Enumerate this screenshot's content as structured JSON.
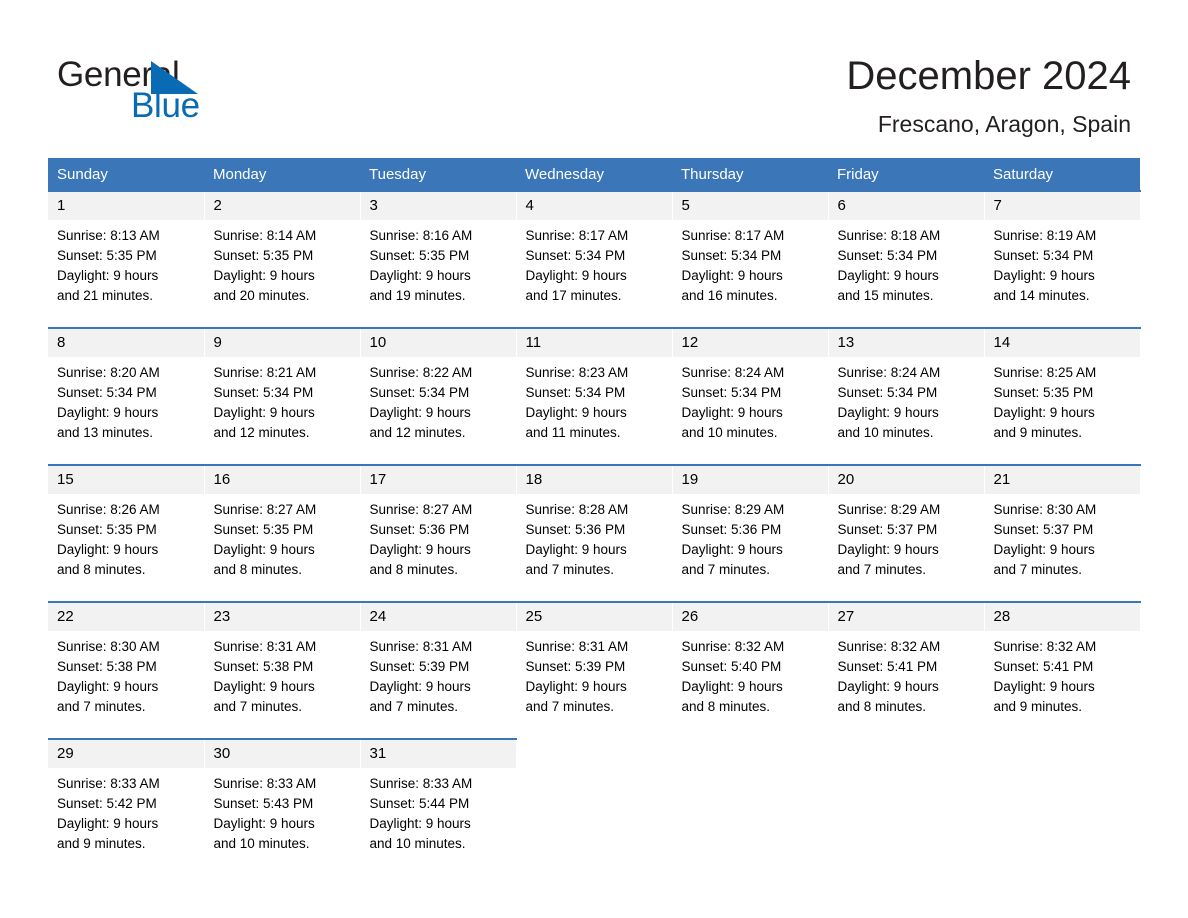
{
  "brand": {
    "name_part1": "General",
    "name_part2": "Blue",
    "accent_color": "#0a6bb5",
    "triangle_icon": "triangle-icon"
  },
  "header": {
    "title": "December 2024",
    "location": "Frescano, Aragon, Spain"
  },
  "calendar": {
    "header_bg": "#3a76b8",
    "daynum_bg": "#f2f2f2",
    "weekday_headers": [
      "Sunday",
      "Monday",
      "Tuesday",
      "Wednesday",
      "Thursday",
      "Friday",
      "Saturday"
    ],
    "weeks": [
      [
        {
          "day": "1",
          "sunrise": "Sunrise: 8:13 AM",
          "sunset": "Sunset: 5:35 PM",
          "daylight_line1": "Daylight: 9 hours",
          "daylight_line2": "and 21 minutes."
        },
        {
          "day": "2",
          "sunrise": "Sunrise: 8:14 AM",
          "sunset": "Sunset: 5:35 PM",
          "daylight_line1": "Daylight: 9 hours",
          "daylight_line2": "and 20 minutes."
        },
        {
          "day": "3",
          "sunrise": "Sunrise: 8:16 AM",
          "sunset": "Sunset: 5:35 PM",
          "daylight_line1": "Daylight: 9 hours",
          "daylight_line2": "and 19 minutes."
        },
        {
          "day": "4",
          "sunrise": "Sunrise: 8:17 AM",
          "sunset": "Sunset: 5:34 PM",
          "daylight_line1": "Daylight: 9 hours",
          "daylight_line2": "and 17 minutes."
        },
        {
          "day": "5",
          "sunrise": "Sunrise: 8:17 AM",
          "sunset": "Sunset: 5:34 PM",
          "daylight_line1": "Daylight: 9 hours",
          "daylight_line2": "and 16 minutes."
        },
        {
          "day": "6",
          "sunrise": "Sunrise: 8:18 AM",
          "sunset": "Sunset: 5:34 PM",
          "daylight_line1": "Daylight: 9 hours",
          "daylight_line2": "and 15 minutes."
        },
        {
          "day": "7",
          "sunrise": "Sunrise: 8:19 AM",
          "sunset": "Sunset: 5:34 PM",
          "daylight_line1": "Daylight: 9 hours",
          "daylight_line2": "and 14 minutes."
        }
      ],
      [
        {
          "day": "8",
          "sunrise": "Sunrise: 8:20 AM",
          "sunset": "Sunset: 5:34 PM",
          "daylight_line1": "Daylight: 9 hours",
          "daylight_line2": "and 13 minutes."
        },
        {
          "day": "9",
          "sunrise": "Sunrise: 8:21 AM",
          "sunset": "Sunset: 5:34 PM",
          "daylight_line1": "Daylight: 9 hours",
          "daylight_line2": "and 12 minutes."
        },
        {
          "day": "10",
          "sunrise": "Sunrise: 8:22 AM",
          "sunset": "Sunset: 5:34 PM",
          "daylight_line1": "Daylight: 9 hours",
          "daylight_line2": "and 12 minutes."
        },
        {
          "day": "11",
          "sunrise": "Sunrise: 8:23 AM",
          "sunset": "Sunset: 5:34 PM",
          "daylight_line1": "Daylight: 9 hours",
          "daylight_line2": "and 11 minutes."
        },
        {
          "day": "12",
          "sunrise": "Sunrise: 8:24 AM",
          "sunset": "Sunset: 5:34 PM",
          "daylight_line1": "Daylight: 9 hours",
          "daylight_line2": "and 10 minutes."
        },
        {
          "day": "13",
          "sunrise": "Sunrise: 8:24 AM",
          "sunset": "Sunset: 5:34 PM",
          "daylight_line1": "Daylight: 9 hours",
          "daylight_line2": "and 10 minutes."
        },
        {
          "day": "14",
          "sunrise": "Sunrise: 8:25 AM",
          "sunset": "Sunset: 5:35 PM",
          "daylight_line1": "Daylight: 9 hours",
          "daylight_line2": "and 9 minutes."
        }
      ],
      [
        {
          "day": "15",
          "sunrise": "Sunrise: 8:26 AM",
          "sunset": "Sunset: 5:35 PM",
          "daylight_line1": "Daylight: 9 hours",
          "daylight_line2": "and 8 minutes."
        },
        {
          "day": "16",
          "sunrise": "Sunrise: 8:27 AM",
          "sunset": "Sunset: 5:35 PM",
          "daylight_line1": "Daylight: 9 hours",
          "daylight_line2": "and 8 minutes."
        },
        {
          "day": "17",
          "sunrise": "Sunrise: 8:27 AM",
          "sunset": "Sunset: 5:36 PM",
          "daylight_line1": "Daylight: 9 hours",
          "daylight_line2": "and 8 minutes."
        },
        {
          "day": "18",
          "sunrise": "Sunrise: 8:28 AM",
          "sunset": "Sunset: 5:36 PM",
          "daylight_line1": "Daylight: 9 hours",
          "daylight_line2": "and 7 minutes."
        },
        {
          "day": "19",
          "sunrise": "Sunrise: 8:29 AM",
          "sunset": "Sunset: 5:36 PM",
          "daylight_line1": "Daylight: 9 hours",
          "daylight_line2": "and 7 minutes."
        },
        {
          "day": "20",
          "sunrise": "Sunrise: 8:29 AM",
          "sunset": "Sunset: 5:37 PM",
          "daylight_line1": "Daylight: 9 hours",
          "daylight_line2": "and 7 minutes."
        },
        {
          "day": "21",
          "sunrise": "Sunrise: 8:30 AM",
          "sunset": "Sunset: 5:37 PM",
          "daylight_line1": "Daylight: 9 hours",
          "daylight_line2": "and 7 minutes."
        }
      ],
      [
        {
          "day": "22",
          "sunrise": "Sunrise: 8:30 AM",
          "sunset": "Sunset: 5:38 PM",
          "daylight_line1": "Daylight: 9 hours",
          "daylight_line2": "and 7 minutes."
        },
        {
          "day": "23",
          "sunrise": "Sunrise: 8:31 AM",
          "sunset": "Sunset: 5:38 PM",
          "daylight_line1": "Daylight: 9 hours",
          "daylight_line2": "and 7 minutes."
        },
        {
          "day": "24",
          "sunrise": "Sunrise: 8:31 AM",
          "sunset": "Sunset: 5:39 PM",
          "daylight_line1": "Daylight: 9 hours",
          "daylight_line2": "and 7 minutes."
        },
        {
          "day": "25",
          "sunrise": "Sunrise: 8:31 AM",
          "sunset": "Sunset: 5:39 PM",
          "daylight_line1": "Daylight: 9 hours",
          "daylight_line2": "and 7 minutes."
        },
        {
          "day": "26",
          "sunrise": "Sunrise: 8:32 AM",
          "sunset": "Sunset: 5:40 PM",
          "daylight_line1": "Daylight: 9 hours",
          "daylight_line2": "and 8 minutes."
        },
        {
          "day": "27",
          "sunrise": "Sunrise: 8:32 AM",
          "sunset": "Sunset: 5:41 PM",
          "daylight_line1": "Daylight: 9 hours",
          "daylight_line2": "and 8 minutes."
        },
        {
          "day": "28",
          "sunrise": "Sunrise: 8:32 AM",
          "sunset": "Sunset: 5:41 PM",
          "daylight_line1": "Daylight: 9 hours",
          "daylight_line2": "and 9 minutes."
        }
      ],
      [
        {
          "day": "29",
          "sunrise": "Sunrise: 8:33 AM",
          "sunset": "Sunset: 5:42 PM",
          "daylight_line1": "Daylight: 9 hours",
          "daylight_line2": "and 9 minutes."
        },
        {
          "day": "30",
          "sunrise": "Sunrise: 8:33 AM",
          "sunset": "Sunset: 5:43 PM",
          "daylight_line1": "Daylight: 9 hours",
          "daylight_line2": "and 10 minutes."
        },
        {
          "day": "31",
          "sunrise": "Sunrise: 8:33 AM",
          "sunset": "Sunset: 5:44 PM",
          "daylight_line1": "Daylight: 9 hours",
          "daylight_line2": "and 10 minutes."
        },
        {
          "day": "",
          "sunrise": "",
          "sunset": "",
          "daylight_line1": "",
          "daylight_line2": ""
        },
        {
          "day": "",
          "sunrise": "",
          "sunset": "",
          "daylight_line1": "",
          "daylight_line2": ""
        },
        {
          "day": "",
          "sunrise": "",
          "sunset": "",
          "daylight_line1": "",
          "daylight_line2": ""
        },
        {
          "day": "",
          "sunrise": "",
          "sunset": "",
          "daylight_line1": "",
          "daylight_line2": ""
        }
      ]
    ]
  }
}
